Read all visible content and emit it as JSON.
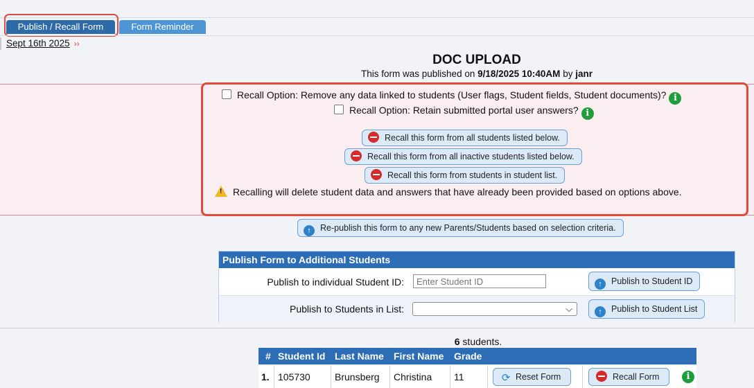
{
  "tabs": {
    "publish_recall": "Publish / Recall Form",
    "form_reminder": "Form Reminder"
  },
  "breadcrumb": {
    "date_link": "Sept 16th 2025",
    "chevron": "››"
  },
  "form": {
    "title": "DOC UPLOAD",
    "published_prefix": "This form was published on ",
    "published_date": "9/18/2025 10:40AM",
    "published_by_word": " by ",
    "published_by": "janr"
  },
  "recall": {
    "option1": "Recall Option: Remove any data linked to students (User flags, Student fields, Student documents)?",
    "option2": "Recall Option: Retain submitted portal user answers?",
    "btn_all": "Recall this form from all students listed below.",
    "btn_inactive": "Recall this form from all inactive students listed below.",
    "btn_list": "Recall this form from students in student list.",
    "warning": "Recalling will delete student data and answers that have already been provided based on options above."
  },
  "republish": {
    "label": "Re-publish this form to any new Parents/Students based on selection criteria."
  },
  "publish_panel": {
    "header": "Publish Form to Additional Students",
    "student_id_label": "Publish to individual Student ID:",
    "student_id_placeholder": "Enter Student ID",
    "student_id_button": "Publish to Student ID",
    "list_label": "Publish to Students in List:",
    "list_value": "",
    "list_button": "Publish to Student List"
  },
  "students": {
    "count": "6",
    "count_suffix": " students.",
    "columns": [
      "#",
      "Student Id",
      "Last Name",
      "First Name",
      "Grade"
    ],
    "rows": [
      {
        "num": "1.",
        "student_id": "105730",
        "last_name": "Brunsberg",
        "first_name": "Christina",
        "grade": "11",
        "reset_label": "Reset Form",
        "recall_label": "Recall Form"
      }
    ]
  },
  "colors": {
    "accent_blue": "#2c6db6",
    "highlight_red": "#e04a3b",
    "recall_band": "#fbeef1",
    "info_green": "#1f9d3b"
  }
}
